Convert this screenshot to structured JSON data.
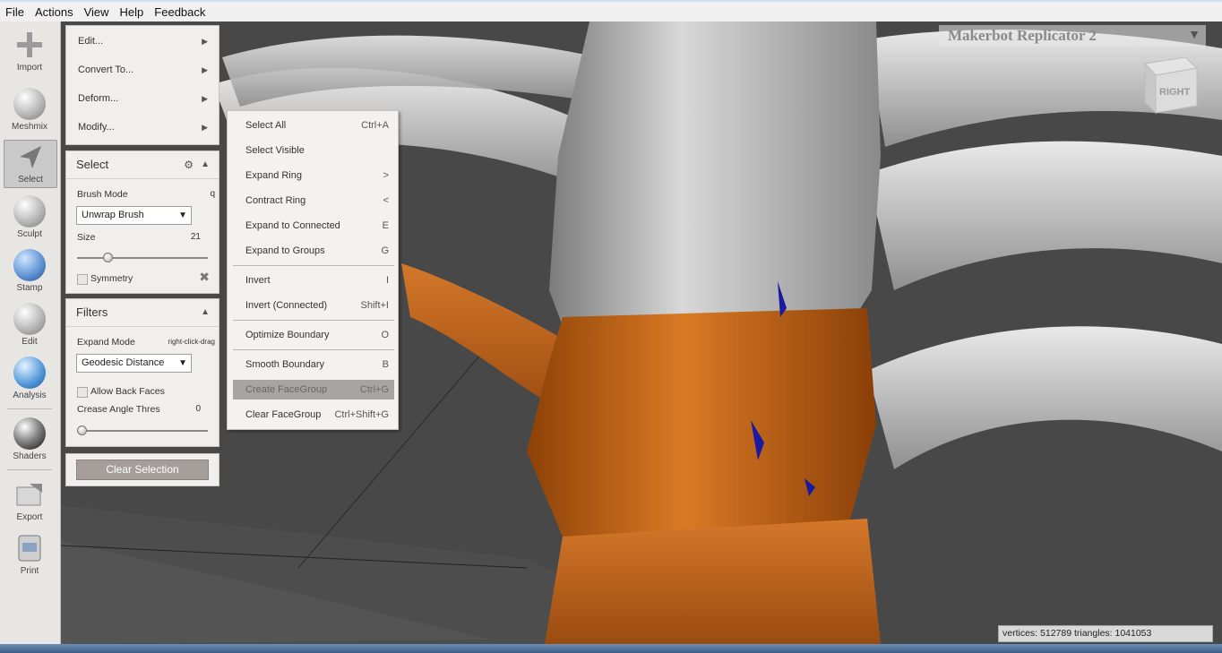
{
  "menubar": [
    "File",
    "Actions",
    "View",
    "Help",
    "Feedback"
  ],
  "toolbar": [
    {
      "label": "Import",
      "icon": "plus-icon"
    },
    {
      "label": "Meshmix",
      "icon": "meshmix-icon"
    },
    {
      "label": "Select",
      "icon": "select-arrow-icon"
    },
    {
      "label": "Sculpt",
      "icon": "brush-icon"
    },
    {
      "label": "Stamp",
      "icon": "stamp-icon"
    },
    {
      "label": "Edit",
      "icon": "edit-icon"
    },
    {
      "label": "Analysis",
      "icon": "analysis-icon"
    },
    {
      "label": "Shaders",
      "icon": "shader-sphere-icon"
    },
    {
      "label": "Export",
      "icon": "export-icon"
    },
    {
      "label": "Print",
      "icon": "print-icon"
    }
  ],
  "edit_menu": [
    "Edit...",
    "Convert To...",
    "Deform...",
    "Modify..."
  ],
  "select_panel": {
    "title": "Select",
    "brush_mode_label": "Brush Mode",
    "brush_mode_shortcut": "q",
    "brush_mode_value": "Unwrap Brush",
    "size_label": "Size",
    "size_value": "21",
    "symmetry_label": "Symmetry"
  },
  "filters_panel": {
    "title": "Filters",
    "expand_mode_label": "Expand Mode",
    "expand_mode_hint": "right-click-drag",
    "expand_mode_value": "Geodesic Distance",
    "allow_back_faces_label": "Allow Back Faces",
    "crease_label": "Crease Angle Thres",
    "crease_value": "0"
  },
  "clear_selection_label": "Clear Selection",
  "modify_submenu": [
    {
      "label": "Select All",
      "key": "Ctrl+A"
    },
    {
      "label": "Select Visible",
      "key": ""
    },
    {
      "label": "Expand Ring",
      "key": ">"
    },
    {
      "label": "Contract Ring",
      "key": "<"
    },
    {
      "label": "Expand to Connected",
      "key": "E"
    },
    {
      "label": "Expand to Groups",
      "key": "G"
    },
    {
      "label": "Invert",
      "key": "I"
    },
    {
      "label": "Invert (Connected)",
      "key": "Shift+I"
    },
    {
      "label": "Optimize Boundary",
      "key": "O"
    },
    {
      "label": "Smooth Boundary",
      "key": "B"
    },
    {
      "label": "Create FaceGroup",
      "key": "Ctrl+G"
    },
    {
      "label": "Clear FaceGroup",
      "key": "Ctrl+Shift+G"
    }
  ],
  "printer": "Makerbot Replicator 2",
  "view_cube_label": "RIGHT",
  "stats": "vertices: 512789  triangles: 1041053",
  "colors": {
    "selection": "#c8671a",
    "mesh": "#cfcfcf",
    "panel_bg": "#f1efed"
  }
}
